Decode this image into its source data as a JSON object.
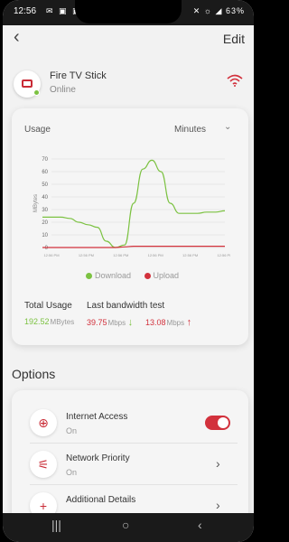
{
  "status_bar": {
    "time": "12:56",
    "icons": "✉ ▣ ▣ •",
    "right": "✕ ☼ ◢ 63%",
    "battery": "63%"
  },
  "header": {
    "back_glyph": "‹",
    "edit_label": "Edit"
  },
  "device": {
    "name": "Fire TV Stick",
    "status": "Online",
    "icon": "tv-icon",
    "status_color": "#7cc242",
    "signal_icon": "wifi-icon"
  },
  "usage": {
    "label": "Usage",
    "unit_select": "Minutes",
    "legend": [
      {
        "name": "Download",
        "color": "#7cc242"
      },
      {
        "name": "Upload",
        "color": "#d2313c"
      }
    ],
    "total_label": "Total Usage",
    "total_value": "192.52",
    "total_unit": "MBytes",
    "bw_label": "Last bandwidth test",
    "download_value": "39.75",
    "download_unit": "Mbps",
    "upload_value": "13.08",
    "upload_unit": "Mbps"
  },
  "chart_data": {
    "type": "line",
    "title": "",
    "xlabel": "",
    "ylabel": "MBytes",
    "ylim": [
      0,
      70
    ],
    "yticks": [
      0,
      10,
      20,
      30,
      40,
      50,
      60,
      70
    ],
    "x_tick_labels": [
      "12:56 PM",
      "12:56 PM",
      "12:56 PM",
      "12:56 PM",
      "12:56 PM",
      "12:56 PM"
    ],
    "x": [
      0,
      1,
      2,
      3,
      4,
      5,
      6,
      7,
      8,
      9,
      10,
      11,
      12,
      13,
      14,
      15,
      16,
      17,
      18,
      19,
      20
    ],
    "series": [
      {
        "name": "Download",
        "color": "#7cc242",
        "values": [
          24,
          24,
          24,
          23,
          20,
          18,
          16,
          5,
          0,
          2,
          35,
          62,
          69,
          60,
          35,
          27,
          27,
          27,
          28,
          28,
          29
        ]
      },
      {
        "name": "Upload",
        "color": "#d2313c",
        "values": [
          0,
          0,
          0,
          0,
          0,
          0,
          0,
          0,
          0,
          0.5,
          1,
          1,
          1,
          1,
          1,
          1,
          1,
          1,
          1,
          1,
          1
        ]
      }
    ],
    "grid": true,
    "legend_position": "bottom"
  },
  "options": {
    "title": "Options",
    "items": [
      {
        "icon": "globe-icon",
        "glyph": "⊕",
        "title": "Internet Access",
        "sub": "On",
        "control": "toggle",
        "toggle_on": true
      },
      {
        "icon": "priority-icon",
        "glyph": "⚟",
        "title": "Network Priority",
        "sub": "On",
        "control": "chevron"
      },
      {
        "icon": "add-icon",
        "glyph": "+",
        "title": "Additional Details",
        "sub": "",
        "control": "chevron"
      }
    ]
  },
  "nav": {
    "recent": "|||",
    "home": "○",
    "back": "‹"
  }
}
